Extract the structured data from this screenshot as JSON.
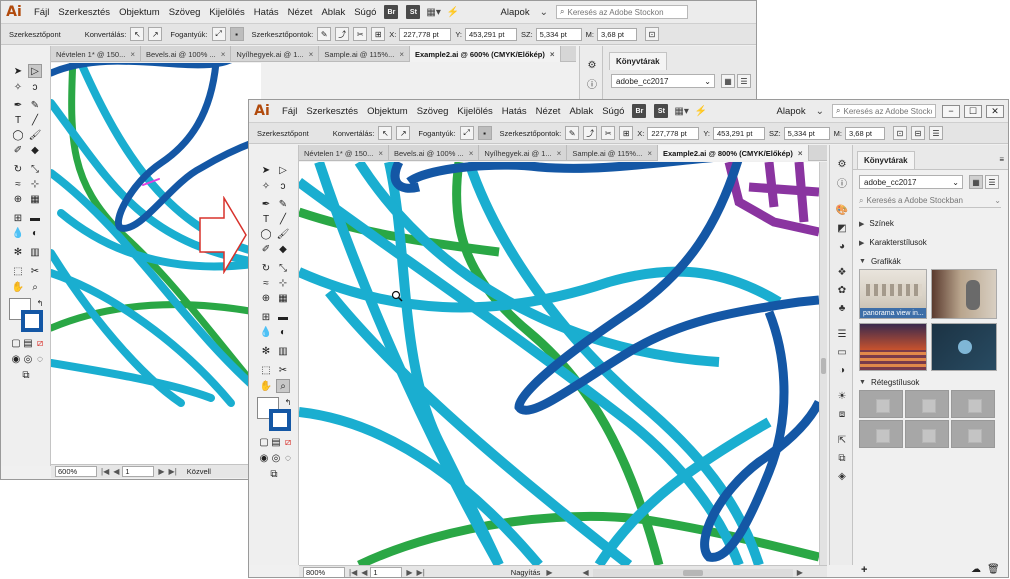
{
  "app": {
    "logo": "Ai",
    "menu": [
      "Fájl",
      "Szerkesztés",
      "Objektum",
      "Szöveg",
      "Kijelölés",
      "Hatás",
      "Nézet",
      "Ablak",
      "Súgó"
    ],
    "badges": [
      "Br",
      "St"
    ],
    "workspace": "Alapok",
    "search_placeholder": "Keresés az Adobe Stockon",
    "window_buttons": [
      "−",
      "☐",
      "✕"
    ]
  },
  "control_bar": {
    "anchor_label": "Szerkesztőpont",
    "convert_label": "Konvertálás:",
    "handles_label": "Fogantyúk:",
    "anchors_label": "Szerkesztőpontok:",
    "x_label": "X:",
    "x_value": "227,778 pt",
    "y_label": "Y:",
    "y_value": "453,291 pt",
    "w_label": "SZ:",
    "w_value": "5,334 pt",
    "h_label": "M:",
    "h_value": "3,68 pt"
  },
  "tabs": [
    {
      "label": "Névtelen 1* @ 150..."
    },
    {
      "label": "Bevels.ai @ 100% ..."
    },
    {
      "label": "Nyílhegyek.ai @ 1..."
    },
    {
      "label": "Sample.ai @ 115%..."
    }
  ],
  "active_tab_back": "Example2.ai @ 600% (CMYK/Előkép)",
  "active_tab_front": "Example2.ai @ 800% (CMYK/Előkép)",
  "status_back": {
    "zoom": "600%",
    "page": "1",
    "mode": "Közvell"
  },
  "status_front": {
    "zoom": "800%",
    "page": "1",
    "mode": "Nagyítás"
  },
  "libraries": {
    "tab": "Könyvtárak",
    "library": "adobe_cc2017",
    "search_placeholder": "Keresés a Adobe Stockban",
    "sections": [
      "Színek",
      "Karakterstílusok",
      "Grafikák",
      "Rétegstílusok"
    ],
    "thumb_label": "panorama view in..."
  },
  "colors": {
    "dark_blue": "#1457a5",
    "cyan": "#1aaed0",
    "green": "#2aa745",
    "purple": "#8a34a0",
    "arrow_red": "#d8322c",
    "accent_brown": "#b14a0c"
  }
}
